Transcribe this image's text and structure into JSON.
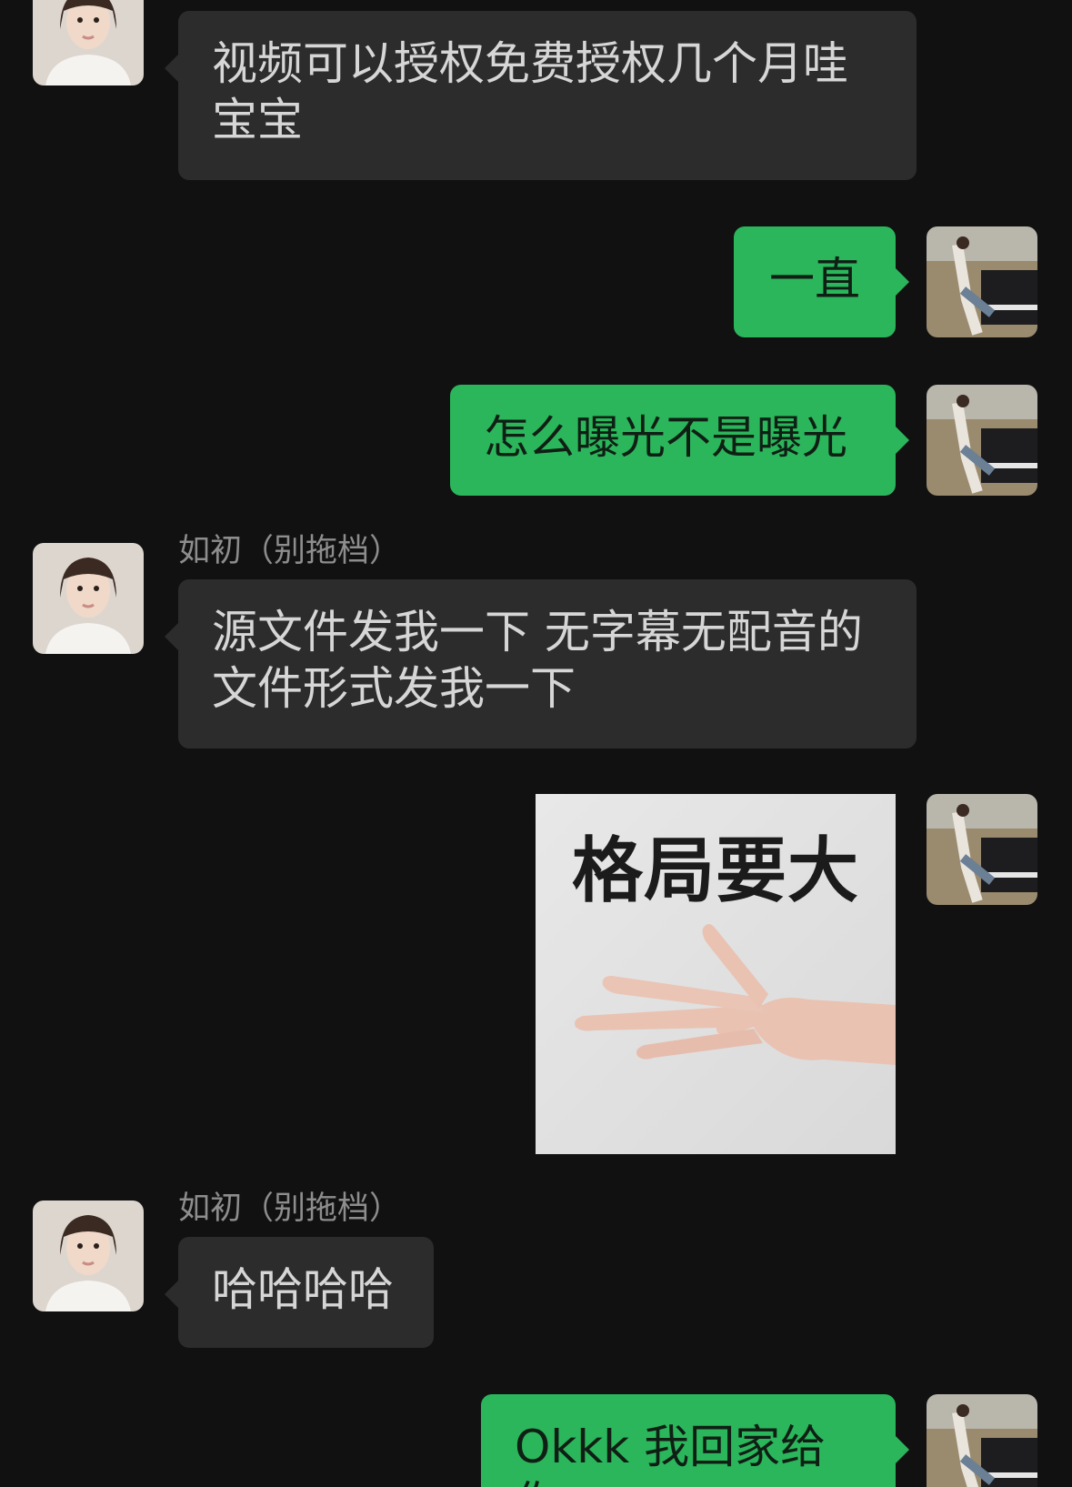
{
  "messages": [
    {
      "direction": "incoming",
      "sender": "",
      "text": "视频可以授权免费授权几个月哇\n宝宝"
    },
    {
      "direction": "outgoing",
      "text": "一直"
    },
    {
      "direction": "outgoing",
      "text": "怎么曝光不是曝光"
    },
    {
      "direction": "incoming",
      "sender": "如初（别拖档）",
      "text": "源文件发我一下 无字幕无配音的\n文件形式发我一下"
    },
    {
      "direction": "outgoing",
      "type": "sticker",
      "sticker_text": "格局要大"
    },
    {
      "direction": "incoming",
      "sender": "如初（别拖档）",
      "text": "哈哈哈哈"
    },
    {
      "direction": "outgoing",
      "text": "Okkk 我回家给你"
    }
  ],
  "colors": {
    "background": "#111111",
    "incoming_bubble": "#2c2c2c",
    "outgoing_bubble": "#2bb65c"
  }
}
